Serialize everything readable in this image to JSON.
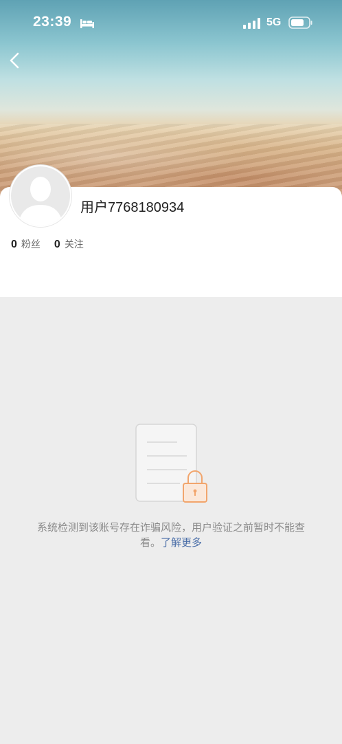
{
  "status_bar": {
    "time": "23:39",
    "network": "5G",
    "icons": [
      "bed-icon",
      "signal-icon",
      "battery-icon"
    ]
  },
  "header": {
    "back_icon": "chevron-left-icon"
  },
  "profile": {
    "avatar_icon": "default-avatar-icon",
    "username": "用户7768180934",
    "stats": [
      {
        "value": "0",
        "label": "粉丝"
      },
      {
        "value": "0",
        "label": "关注"
      }
    ]
  },
  "notice": {
    "illustration_icon": "locked-document-icon",
    "text": "系统检测到该账号存在诈骗风险，用户验证之前暂时不能查看。",
    "link": "了解更多"
  },
  "colors": {
    "background": "#ededed",
    "card": "#ffffff",
    "link": "#4a6ea8",
    "lock_accent": "#f2a56c"
  }
}
